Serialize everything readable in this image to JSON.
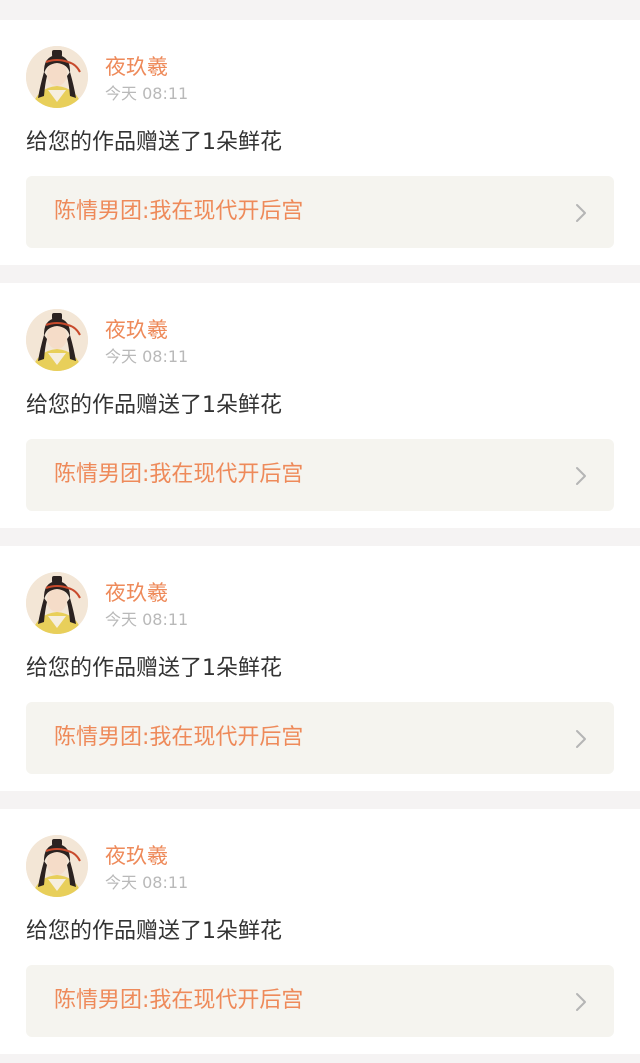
{
  "colors": {
    "accent": "#ee8a5a",
    "timestamp": "#b9b9b9",
    "body_text": "#333333",
    "link_bg": "#f5f4ef",
    "page_bg": "#f5f3f3"
  },
  "notifications": [
    {
      "user_name": "夜玖羲",
      "timestamp": "今天 08:11",
      "message": "给您的作品赠送了1朵鲜花",
      "work_title": "陈情男团:我在现代开后宫",
      "avatar_icon": "user-avatar",
      "chevron_icon": "chevron-right-icon"
    },
    {
      "user_name": "夜玖羲",
      "timestamp": "今天 08:11",
      "message": "给您的作品赠送了1朵鲜花",
      "work_title": "陈情男团:我在现代开后宫",
      "avatar_icon": "user-avatar",
      "chevron_icon": "chevron-right-icon"
    },
    {
      "user_name": "夜玖羲",
      "timestamp": "今天 08:11",
      "message": "给您的作品赠送了1朵鲜花",
      "work_title": "陈情男团:我在现代开后宫",
      "avatar_icon": "user-avatar",
      "chevron_icon": "chevron-right-icon"
    },
    {
      "user_name": "夜玖羲",
      "timestamp": "今天 08:11",
      "message": "给您的作品赠送了1朵鲜花",
      "work_title": "陈情男团:我在现代开后宫",
      "avatar_icon": "user-avatar",
      "chevron_icon": "chevron-right-icon"
    }
  ]
}
